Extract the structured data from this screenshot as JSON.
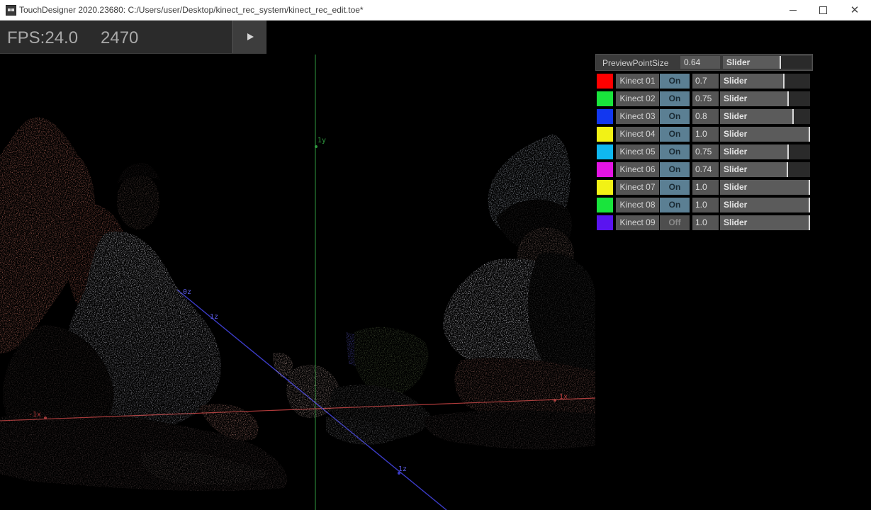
{
  "window": {
    "title": "TouchDesigner 2020.23680: C:/Users/user/Desktop/kinect_rec_system/kinect_rec_edit.toe*"
  },
  "hud": {
    "fps_text": "FPS:24.0",
    "frame_text": "2470",
    "play_icon": "play-icon"
  },
  "viewport": {
    "axis_labels": {
      "y_pos": "1y",
      "x_neg": "-1x",
      "x_pos": "1x",
      "z_pos": "1z",
      "z_upper": "0z",
      "z_ticks": "1z"
    },
    "colors": {
      "x_axis": "#b03a3a",
      "y_axis": "#2f9a3f",
      "z_axis": "#3c3cc8"
    }
  },
  "panel": {
    "preview_point_size": {
      "label": "PreviewPointSize",
      "value": "0.64",
      "value_num": 0.64,
      "slider_label": "Slider"
    },
    "kinects": [
      {
        "name": "Kinect 01",
        "color": "#ff0000",
        "state": "On",
        "value": "0.7",
        "value_num": 0.7,
        "slider_label": "Slider"
      },
      {
        "name": "Kinect 02",
        "color": "#19e43c",
        "state": "On",
        "value": "0.75",
        "value_num": 0.75,
        "slider_label": "Slider"
      },
      {
        "name": "Kinect 03",
        "color": "#1237f0",
        "state": "On",
        "value": "0.8",
        "value_num": 0.8,
        "slider_label": "Slider"
      },
      {
        "name": "Kinect 04",
        "color": "#f2f215",
        "state": "On",
        "value": "1.0",
        "value_num": 1.0,
        "slider_label": "Slider"
      },
      {
        "name": "Kinect 05",
        "color": "#0fb8f0",
        "state": "On",
        "value": "0.75",
        "value_num": 0.75,
        "slider_label": "Slider"
      },
      {
        "name": "Kinect 06",
        "color": "#e414e4",
        "state": "On",
        "value": "0.74",
        "value_num": 0.74,
        "slider_label": "Slider"
      },
      {
        "name": "Kinect 07",
        "color": "#f2f215",
        "state": "On",
        "value": "1.0",
        "value_num": 1.0,
        "slider_label": "Slider"
      },
      {
        "name": "Kinect 08",
        "color": "#19e43c",
        "state": "On",
        "value": "1.0",
        "value_num": 1.0,
        "slider_label": "Slider"
      },
      {
        "name": "Kinect 09",
        "color": "#5a14f0",
        "state": "Off",
        "value": "1.0",
        "value_num": 1.0,
        "slider_label": "Slider"
      }
    ]
  }
}
